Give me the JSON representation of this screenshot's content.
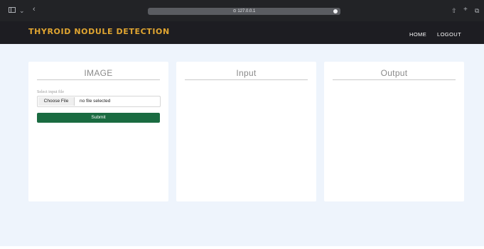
{
  "browser": {
    "url": "127.0.0.1",
    "icons": [
      "sidebar-icon",
      "chevron-down-icon",
      "back-icon",
      "lock-icon",
      "share-icon",
      "new-tab-icon",
      "tabs-icon"
    ]
  },
  "header": {
    "brand": "THYROID NODULE DETECTION",
    "nav": {
      "home": "HOME",
      "logout": "LOGOUT"
    }
  },
  "panels": {
    "image": {
      "title": "IMAGE",
      "file_label": "Select input file",
      "choose_file": "Choose File",
      "file_status": "no file selected",
      "submit": "Submit"
    },
    "input": {
      "title": "Input"
    },
    "output": {
      "title": "Output"
    }
  },
  "colors": {
    "header_bg": "#1d1d22",
    "brand": "#e0a531",
    "page_bg": "#eef4fc",
    "submit_bg": "#1a6b41"
  }
}
